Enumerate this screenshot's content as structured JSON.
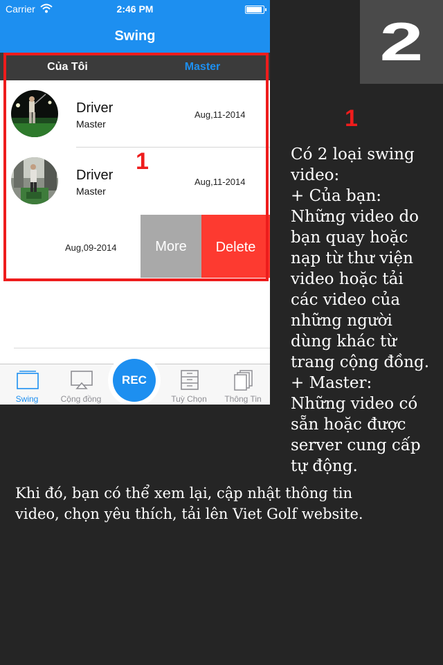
{
  "status_bar": {
    "carrier": "Carrier",
    "time": "2:46 PM"
  },
  "nav": {
    "title": "Swing"
  },
  "segments": {
    "mine": "Của Tôi",
    "master": "Master",
    "selected": "master"
  },
  "rows": [
    {
      "title": "Driver",
      "subtitle": "Master",
      "date": "Aug,11-2014"
    },
    {
      "title": "Driver",
      "subtitle": "Master",
      "date": "Aug,11-2014"
    },
    {
      "date": "Aug,09-2014",
      "swipe_actions": [
        "More",
        "Delete"
      ]
    }
  ],
  "tabbar": {
    "items": [
      "Swing",
      "Cộng đồng",
      "Tuỳ Chọn",
      "Thông Tin"
    ],
    "rec": "REC",
    "selected": "Swing"
  },
  "annotation": {
    "step": "2",
    "marker_inner": "1",
    "marker_outer": "1",
    "description_lines": [
      "Có 2 loại swing",
      "video:",
      "+ Của bạn:",
      "Những video do",
      "bạn quay hoặc",
      "nạp từ thư viện",
      "video hoặc tải",
      "các video của",
      "những người",
      "dùng khác từ",
      "trang cộng đồng.",
      "+ Master:",
      "Những video có",
      "sẵn hoặc được",
      "server cung cấp",
      "tự động."
    ],
    "bottom_lines": [
      "Khi đó, bạn có thể xem lại, cập nhật thông tin",
      "video, chọn yêu thích, tải lên Viet Golf website."
    ]
  },
  "colors": {
    "accent": "#1d8ff0",
    "annotation_red": "#ee1c1c",
    "delete_red": "#fd3a30",
    "more_gray": "#a9a9a9",
    "background": "#252525"
  },
  "icons": [
    "wifi-icon",
    "battery-icon",
    "swing-tab-icon",
    "community-tab-icon",
    "options-tab-icon",
    "info-tab-icon"
  ]
}
